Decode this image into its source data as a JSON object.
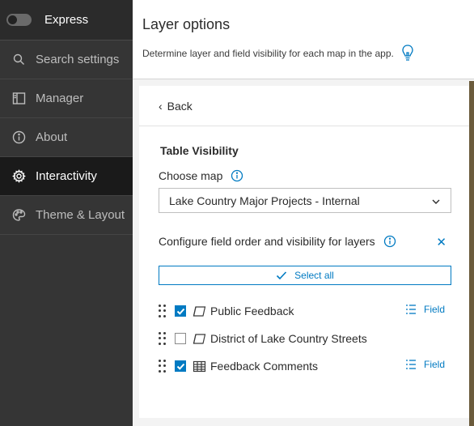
{
  "sidebar": {
    "express_label": "Express",
    "items": [
      {
        "label": "Search settings",
        "icon": "search-icon"
      },
      {
        "label": "Manager",
        "icon": "sidebar-layout-icon"
      },
      {
        "label": "About",
        "icon": "info-icon"
      },
      {
        "label": "Interactivity",
        "icon": "gear-icon",
        "active": true
      },
      {
        "label": "Theme & Layout",
        "icon": "palette-icon"
      }
    ]
  },
  "header": {
    "title": "Layer options",
    "description": "Determine layer and field visibility for each map in the app."
  },
  "panel": {
    "back_label": "Back",
    "section_title": "Table Visibility",
    "choose_map_label": "Choose map",
    "selected_map": "Lake Country Major Projects - Internal",
    "config_label": "Configure field order and visibility for layers",
    "select_all_label": "Select all",
    "layers": [
      {
        "name": "Public Feedback",
        "checked": true,
        "icon": "polygon-layer-icon",
        "field_label": "Field"
      },
      {
        "name": "District of Lake Country Streets",
        "checked": false,
        "icon": "polygon-layer-icon",
        "field_label": ""
      },
      {
        "name": "Feedback Comments",
        "checked": true,
        "icon": "table-icon",
        "field_label": "Field"
      }
    ]
  },
  "colors": {
    "accent": "#007ac2",
    "sidebar_bg": "#353535",
    "sidebar_active_bg": "#1a1a1a"
  }
}
